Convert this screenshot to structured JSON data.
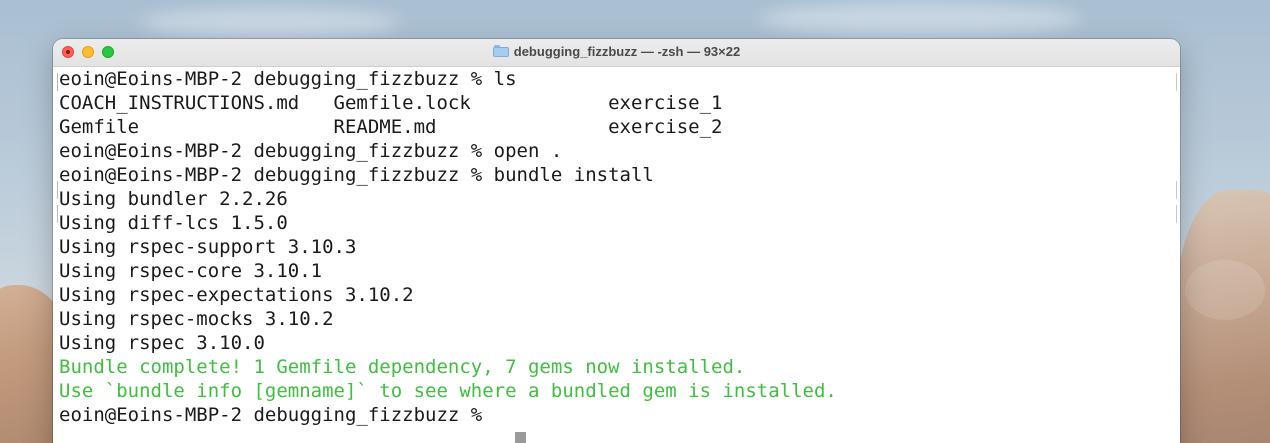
{
  "window": {
    "title": "debugging_fizzbuzz — -zsh — 93×22",
    "title_icon": "folder-icon"
  },
  "terminal": {
    "lines": [
      {
        "text": "eoin@Eoins-MBP-2 debugging_fizzbuzz % ls",
        "color": "default",
        "prompt": true
      },
      {
        "text": "COACH_INSTRUCTIONS.md   Gemfile.lock            exercise_1",
        "color": "default",
        "prompt": false
      },
      {
        "text": "Gemfile                 README.md               exercise_2",
        "color": "default",
        "prompt": false
      },
      {
        "text": "eoin@Eoins-MBP-2 debugging_fizzbuzz % open .",
        "color": "default",
        "prompt": true
      },
      {
        "text": "eoin@Eoins-MBP-2 debugging_fizzbuzz % bundle install",
        "color": "default",
        "prompt": true
      },
      {
        "text": "Using bundler 2.2.26",
        "color": "default",
        "prompt": false
      },
      {
        "text": "Using diff-lcs 1.5.0",
        "color": "default",
        "prompt": false
      },
      {
        "text": "Using rspec-support 3.10.3",
        "color": "default",
        "prompt": false
      },
      {
        "text": "Using rspec-core 3.10.1",
        "color": "default",
        "prompt": false
      },
      {
        "text": "Using rspec-expectations 3.10.2",
        "color": "default",
        "prompt": false
      },
      {
        "text": "Using rspec-mocks 3.10.2",
        "color": "default",
        "prompt": false
      },
      {
        "text": "Using rspec 3.10.0",
        "color": "default",
        "prompt": false
      },
      {
        "text": "Bundle complete! 1 Gemfile dependency, 7 gems now installed.",
        "color": "green",
        "prompt": false
      },
      {
        "text": "Use `bundle info [gemname]` to see where a bundled gem is installed.",
        "color": "green",
        "prompt": false
      },
      {
        "text": "eoin@Eoins-MBP-2 debugging_fizzbuzz % ",
        "color": "default",
        "prompt": true
      }
    ]
  },
  "colors": {
    "text": "#1a1a1a",
    "success_green": "#3fbf3f",
    "close": "#ff5f57",
    "minimize": "#febc2e",
    "zoom": "#28c840"
  }
}
